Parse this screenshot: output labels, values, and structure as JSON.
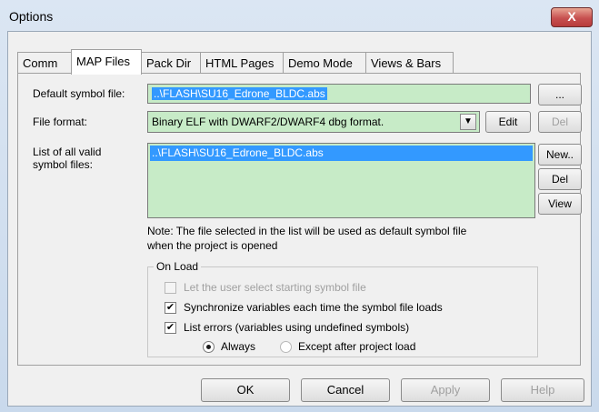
{
  "window": {
    "title": "Options",
    "close_glyph": "X"
  },
  "tabs": [
    {
      "label": "Comm"
    },
    {
      "label": "MAP Files"
    },
    {
      "label": "Pack Dir"
    },
    {
      "label": "HTML Pages"
    },
    {
      "label": "Demo Mode"
    },
    {
      "label": "Views & Bars"
    }
  ],
  "active_tab": "MAP Files",
  "form": {
    "default_symbol_label": "Default symbol file:",
    "default_symbol_value": "..\\FLASH\\SU16_Edrone_BLDC.abs",
    "browse_label": "...",
    "file_format_label": "File format:",
    "file_format_value": "Binary ELF with DWARF2/DWARF4 dbg format.",
    "edit_label": "Edit",
    "del_top_label": "Del",
    "list_label_line1": "List of all valid",
    "list_label_line2": "symbol files:",
    "list_items": [
      "..\\FLASH\\SU16_Edrone_BLDC.abs"
    ],
    "new_label": "New..",
    "del_label": "Del",
    "view_label": "View",
    "note_line1": "Note: The file selected in the list will be used as default symbol file",
    "note_line2": "when the project is opened"
  },
  "on_load": {
    "legend": "On Load",
    "opt_user_select": "Let the user select starting symbol file",
    "opt_sync": "Synchronize variables each time the symbol file loads",
    "opt_list_errors": "List errors (variables using undefined symbols)",
    "radio_always": "Always",
    "radio_except": "Except after project load",
    "check_glyph": "✔"
  },
  "buttons": {
    "ok": "OK",
    "cancel": "Cancel",
    "apply": "Apply",
    "help": "Help"
  },
  "colors": {
    "field_bg": "#c7ebc7",
    "selection": "#3399ff",
    "close_red": "#c75050"
  }
}
